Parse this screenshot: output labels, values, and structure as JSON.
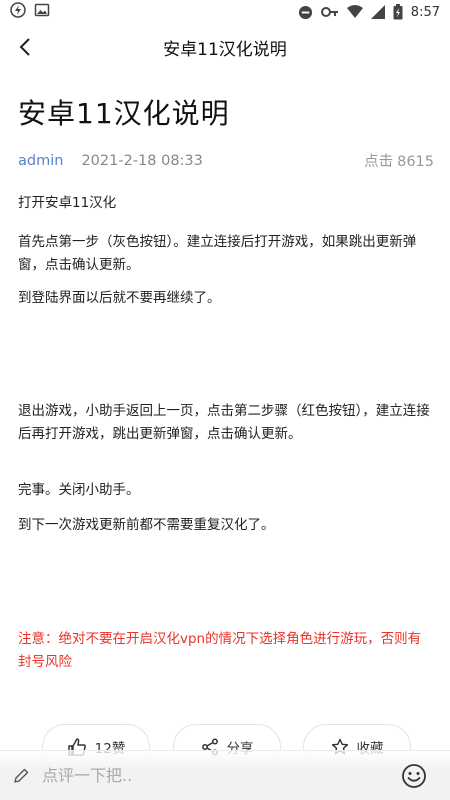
{
  "status_bar": {
    "time": "8:57"
  },
  "nav": {
    "title": "安卓11汉化说明"
  },
  "article": {
    "title": "安卓11汉化说明",
    "author": "admin",
    "date": "2021-2-18 08:33",
    "views_label": "点击",
    "views_count": "8615",
    "paragraphs": [
      "打开安卓11汉化",
      "首先点第一步（灰色按钮）。建立连接后打开游戏，如果跳出更新弹窗，点击确认更新。",
      "到登陆界面以后就不要再继续了。",
      "退出游戏，小助手返回上一页，点击第二步骤（红色按钮），建立连接后再打开游戏，跳出更新弹窗，点击确认更新。",
      "完事。关闭小助手。",
      "到下一次游戏更新前都不需要重复汉化了。"
    ],
    "warning": "注意：绝对不要在开启汉化vpn的情况下选择角色进行游玩，否则有封号风险"
  },
  "actions": {
    "like_label": "12赞",
    "share_label": "分享",
    "favorite_label": "收藏"
  },
  "comment": {
    "placeholder": "点评一下把.."
  },
  "colors": {
    "author": "#5b7fd1",
    "warning": "#e8332a"
  }
}
